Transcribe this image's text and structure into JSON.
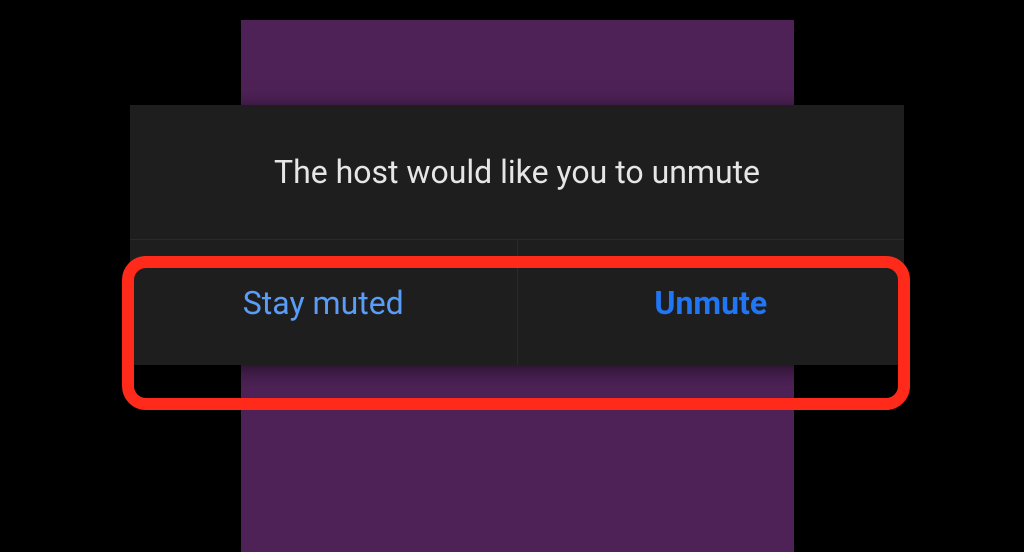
{
  "dialog": {
    "message": "The host would like you to unmute",
    "stay_muted_label": "Stay muted",
    "unmute_label": "Unmute"
  },
  "colors": {
    "background": "#000000",
    "purple_panel": "#4e2257",
    "dialog_bg": "#1e1e1e",
    "text": "#e6e6e6",
    "link_light": "#5a9df8",
    "link_bold": "#2176f5",
    "highlight": "#ff2a1a"
  }
}
